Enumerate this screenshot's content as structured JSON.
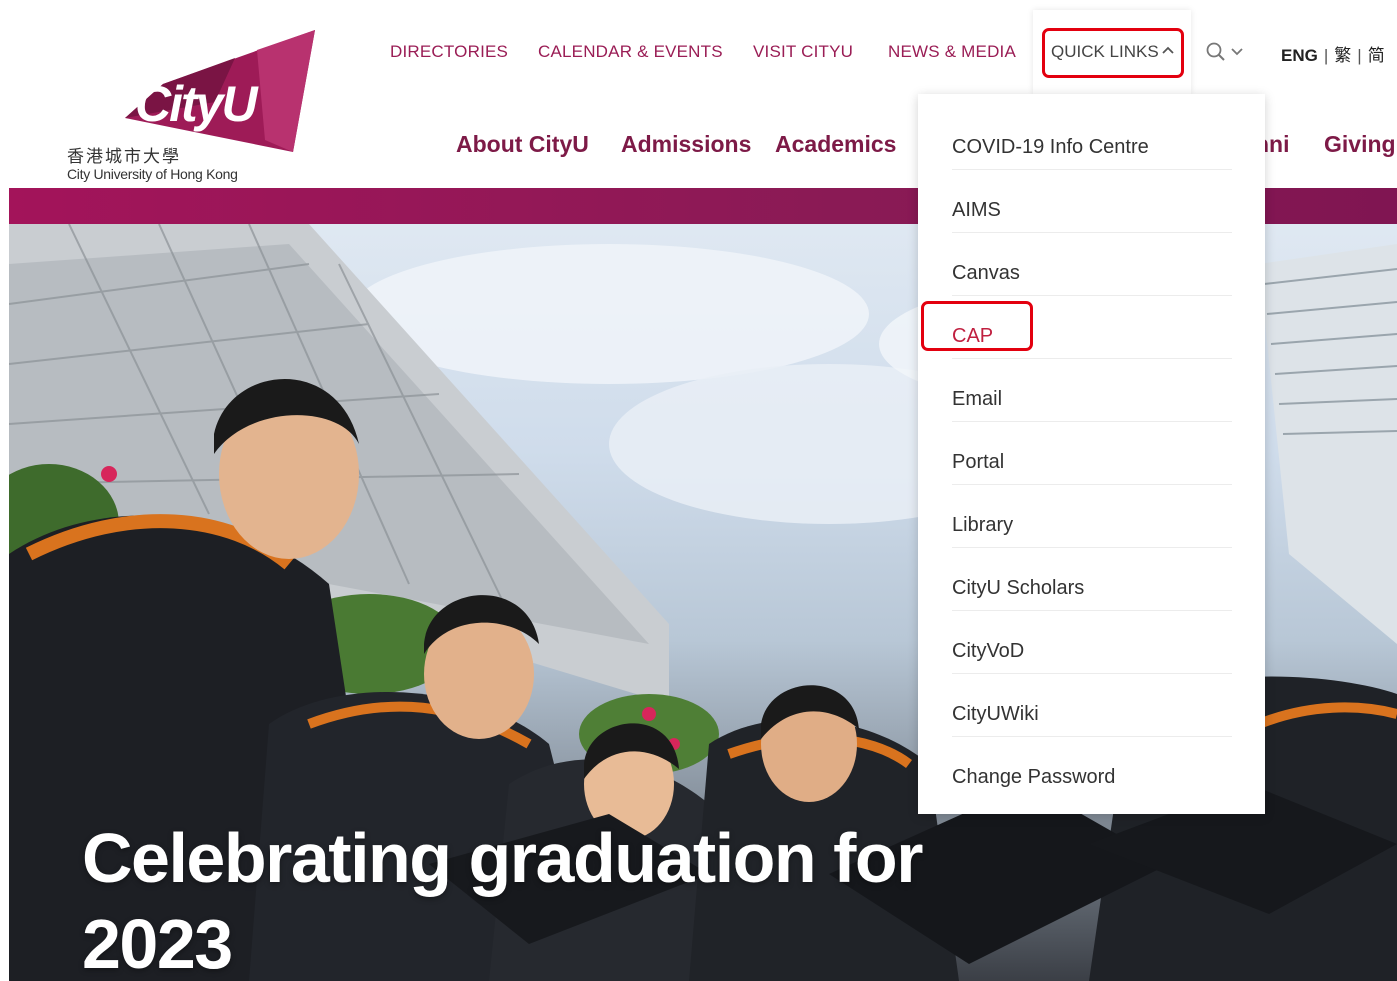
{
  "brand": {
    "logo_text": "CityU",
    "name_cn": "香港城市大學",
    "name_en": "City University of Hong Kong",
    "primary_color": "#9a1d55"
  },
  "utility_nav": {
    "directories": "DIRECTORIES",
    "calendar": "CALENDAR & EVENTS",
    "visit": "VISIT CITYU",
    "news": "NEWS & MEDIA",
    "quick_links": "QUICK LINKS"
  },
  "language": {
    "eng": "ENG",
    "trad": "繁",
    "simp": "简",
    "separator": "|"
  },
  "main_nav": {
    "about": "About CityU",
    "admissions": "Admissions",
    "academics": "Academics",
    "alumni_partial": "nni",
    "giving": "Giving"
  },
  "quick_links": {
    "items": [
      {
        "label": "COVID-19 Info Centre"
      },
      {
        "label": "AIMS"
      },
      {
        "label": "Canvas"
      },
      {
        "label": "CAP"
      },
      {
        "label": "Email"
      },
      {
        "label": "Portal"
      },
      {
        "label": "Library"
      },
      {
        "label": "CityU Scholars"
      },
      {
        "label": "CityVoD"
      },
      {
        "label": "CityUWiki"
      },
      {
        "label": "Change Password"
      }
    ]
  },
  "hero": {
    "headline_line1": "Celebrating graduation for",
    "headline_line2": "2023"
  },
  "icons": {
    "search": "search-icon",
    "chevron_up": "chevron-up-icon",
    "chevron_down": "chevron-down-icon"
  }
}
